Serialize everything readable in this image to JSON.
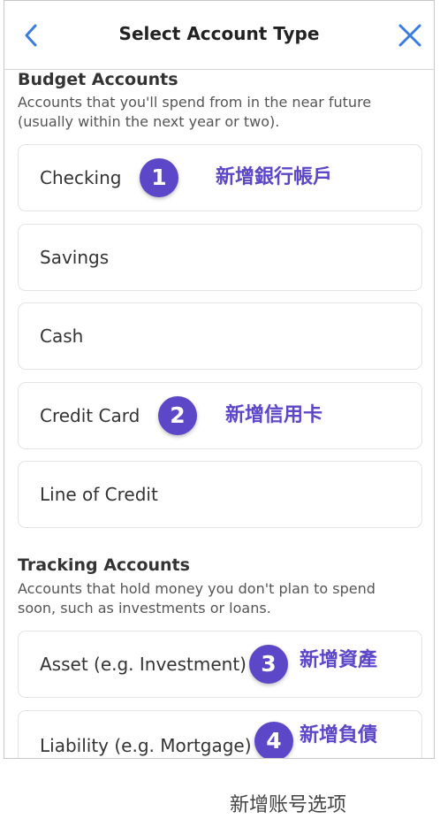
{
  "header": {
    "title": "Select Account Type",
    "back_icon": "chevron-left-icon",
    "close_icon": "close-icon",
    "accent_color": "#3b7ddd"
  },
  "budget": {
    "title": "Budget Accounts",
    "description": "Accounts that you'll spend from in the near future (usually within the next year or two).",
    "items": [
      {
        "label": "Checking",
        "badge": "1",
        "annotation": "新增銀行帳戶"
      },
      {
        "label": "Savings"
      },
      {
        "label": "Cash"
      },
      {
        "label": "Credit Card",
        "badge": "2",
        "annotation": "新增信用卡"
      },
      {
        "label": "Line of Credit"
      }
    ]
  },
  "tracking": {
    "title": "Tracking Accounts",
    "description": "Accounts that hold money you don't plan to spend soon, such as investments or loans.",
    "items": [
      {
        "label": "Asset (e.g. Investment)",
        "badge": "3",
        "annotation": "新增資產"
      },
      {
        "label": "Liability (e.g. Mortgage)",
        "badge": "4",
        "annotation": "新增負債"
      }
    ]
  },
  "badge_color": "#5b47c7",
  "caption": "新增账号选项"
}
